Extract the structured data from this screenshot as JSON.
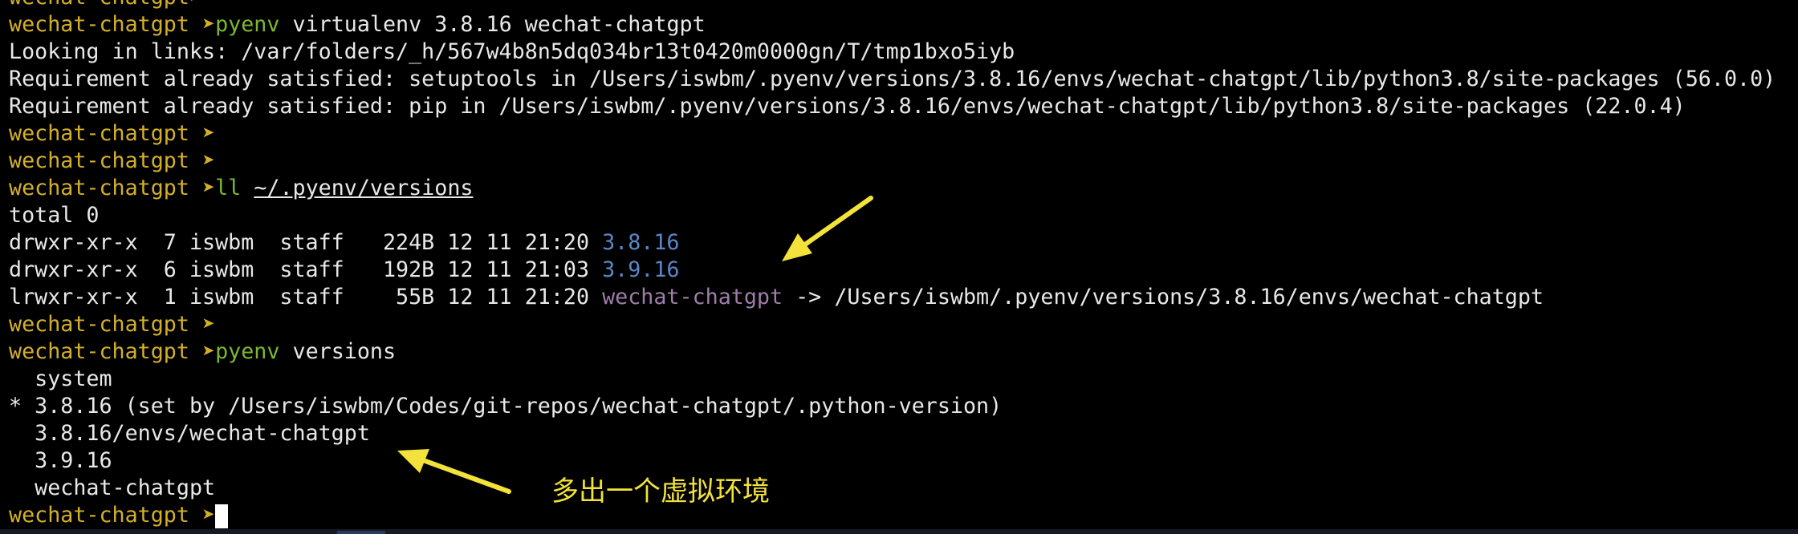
{
  "prompt_label": "wechat-chatgpt",
  "prompt_glyph": "➤",
  "lines": {
    "l0": {
      "prompt": "wechat-chatgpt",
      "cmd": "",
      "args": ""
    },
    "l1": {
      "prompt": "wechat-chatgpt",
      "cmd": "pyenv",
      "args": " virtualenv 3.8.16 wechat-chatgpt"
    },
    "l2": {
      "text": "Looking in links: /var/folders/_h/567w4b8n5dq034br13t0420m0000gn/T/tmp1bxo5iyb"
    },
    "l3": {
      "text": "Requirement already satisfied: setuptools in /Users/iswbm/.pyenv/versions/3.8.16/envs/wechat-chatgpt/lib/python3.8/site-packages (56.0.0)"
    },
    "l4": {
      "text": "Requirement already satisfied: pip in /Users/iswbm/.pyenv/versions/3.8.16/envs/wechat-chatgpt/lib/python3.8/site-packages (22.0.4)"
    },
    "l5": {
      "prompt": "wechat-chatgpt"
    },
    "l6": {
      "prompt": "wechat-chatgpt"
    },
    "l7": {
      "prompt": "wechat-chatgpt",
      "cmd": "ll",
      "args": "~/.pyenv/versions"
    },
    "l8": {
      "text": "total 0"
    },
    "l9": {
      "meta": "drwxr-xr-x  7 iswbm  staff   224B 12 11 21:20 ",
      "name": "3.8.16"
    },
    "l10": {
      "meta": "drwxr-xr-x  6 iswbm  staff   192B 12 11 21:03 ",
      "name": "3.9.16"
    },
    "l11": {
      "meta": "lrwxr-xr-x  1 iswbm  staff    55B 12 11 21:20 ",
      "name": "wechat-chatgpt",
      "target": " -> /Users/iswbm/.pyenv/versions/3.8.16/envs/wechat-chatgpt"
    },
    "l12": {
      "prompt": "wechat-chatgpt"
    },
    "l13": {
      "prompt": "wechat-chatgpt",
      "cmd": "pyenv",
      "args": " versions"
    },
    "l14": {
      "text": "  system"
    },
    "l15": {
      "text": "* 3.8.16 (set by /Users/iswbm/Codes/git-repos/wechat-chatgpt/.python-version)"
    },
    "l16": {
      "text": "  3.8.16/envs/wechat-chatgpt"
    },
    "l17": {
      "text": "  3.9.16"
    },
    "l18": {
      "text": "  wechat-chatgpt"
    },
    "l19": {
      "prompt": "wechat-chatgpt"
    }
  },
  "annotation": {
    "text": "多出一个虚拟环境"
  },
  "colors": {
    "background": "#000000",
    "prompt": "#d4b02a",
    "command": "#7cb82f",
    "directory": "#5a86c8",
    "symlink": "#9e7ea8",
    "annotation": "#f2e23a",
    "text": "#e8e8e8"
  },
  "icons": {
    "arrow_top": "yellow-arrow-icon",
    "arrow_bottom": "yellow-arrow-icon",
    "cursor": "block-cursor"
  }
}
